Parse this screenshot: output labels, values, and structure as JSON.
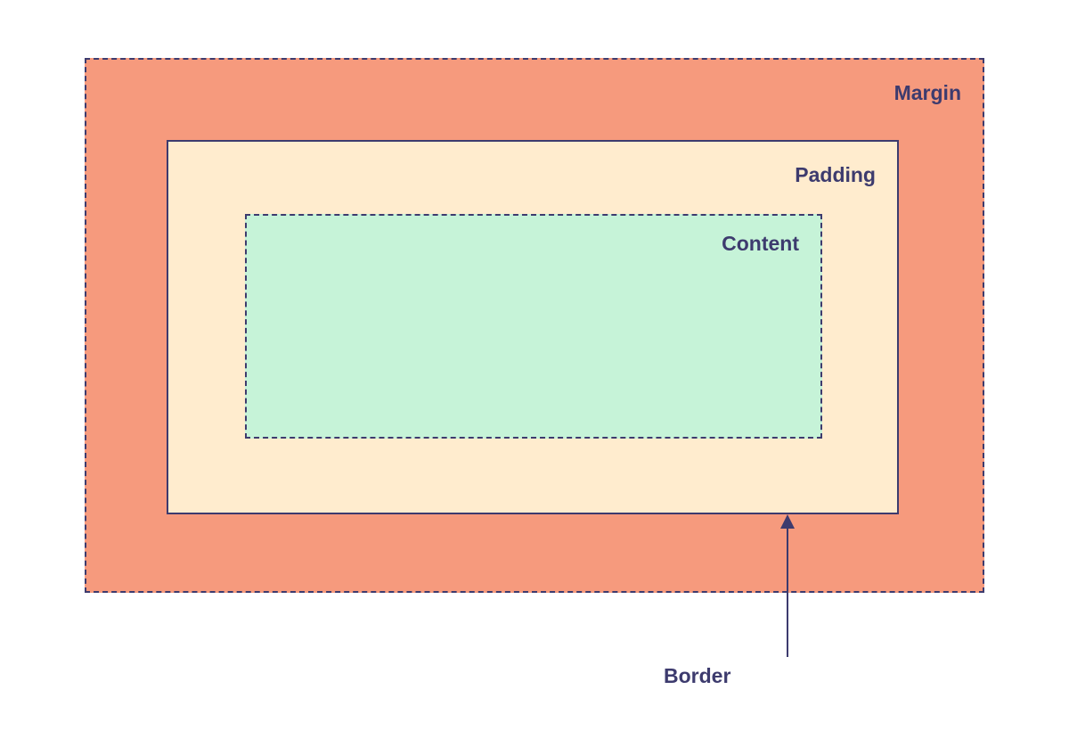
{
  "diagram": {
    "margin_label": "Margin",
    "padding_label": "Padding",
    "content_label": "Content",
    "border_label": "Border",
    "colors": {
      "margin_bg": "#f69a7d",
      "padding_bg": "#ffecce",
      "content_bg": "#c6f3d8",
      "border_color": "#3d3b6e",
      "text_color": "#3d3b6e"
    }
  }
}
